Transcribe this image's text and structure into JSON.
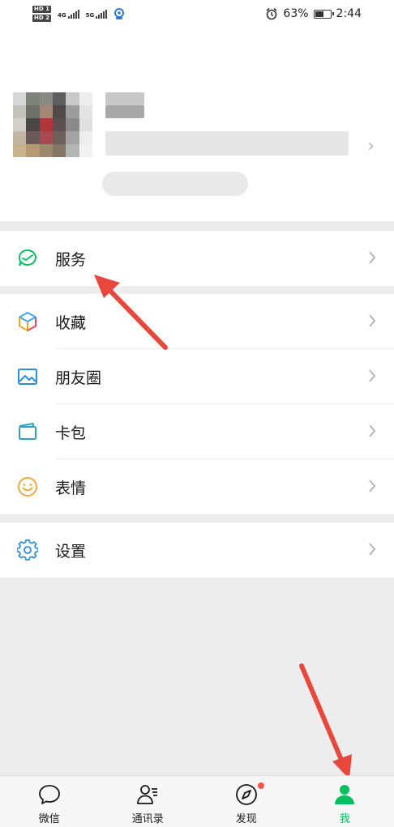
{
  "status_bar": {
    "sim1": "HD 1",
    "sim2": "HD 2",
    "net1": "4G",
    "net2": "5G",
    "battery_percent": "63%",
    "battery_level": 0.63,
    "time": "2:44"
  },
  "menu": {
    "services": "服务",
    "favorites": "收藏",
    "moments": "朋友圈",
    "cards": "卡包",
    "stickers": "表情",
    "settings": "设置"
  },
  "tabs": {
    "chats": "微信",
    "contacts": "通讯录",
    "discover": "发现",
    "me": "我"
  },
  "colors": {
    "accent": "#07c160",
    "arrow": "#e8473c",
    "badge": "#fa5151"
  }
}
